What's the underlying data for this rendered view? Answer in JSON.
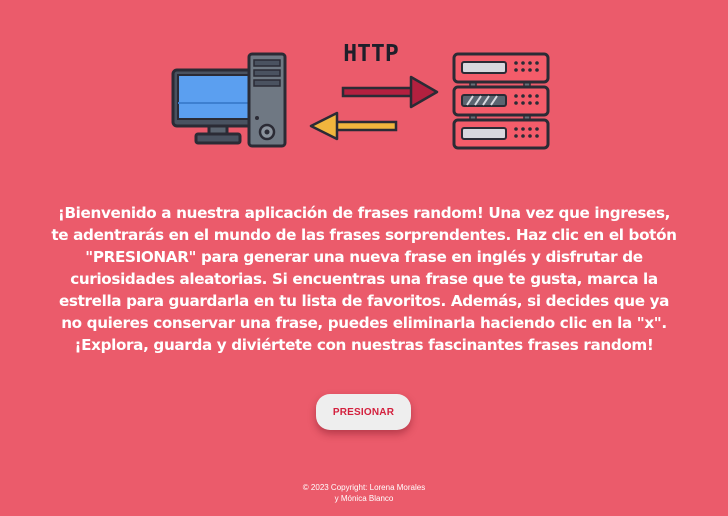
{
  "hero": {
    "protocol_label": "HTTP",
    "icons": [
      "desktop-computer-icon",
      "server-rack-icon",
      "arrow-right-icon",
      "arrow-left-icon"
    ]
  },
  "intro": {
    "text": "¡Bienvenido a nuestra aplicación de frases random!  Una vez que ingreses,\nte adentrarás en el mundo de las frases sorprendentes. Haz clic en el botón\n\"PRESIONAR\" para generar una nueva frase en inglés y disfrutar de\ncuriosidades aleatorias. Si encuentras una frase que te gusta, marca la\nestrella para guardarla en tu lista de favoritos. Además, si decides que ya\nno quieres conservar una frase, puedes eliminarla haciendo clic en la \"x\".\n¡Explora, guarda y diviértete con nuestras fascinantes frases random!"
  },
  "actions": {
    "press_label": "PRESIONAR"
  },
  "footer": {
    "line1": "© 2023 Copyright: Lorena Morales",
    "line2": "y Mónica Blanco"
  },
  "colors": {
    "background": "#eb5b6b",
    "button_text": "#d3203d",
    "button_bg": "#eeeeee",
    "text": "#ffffff"
  }
}
